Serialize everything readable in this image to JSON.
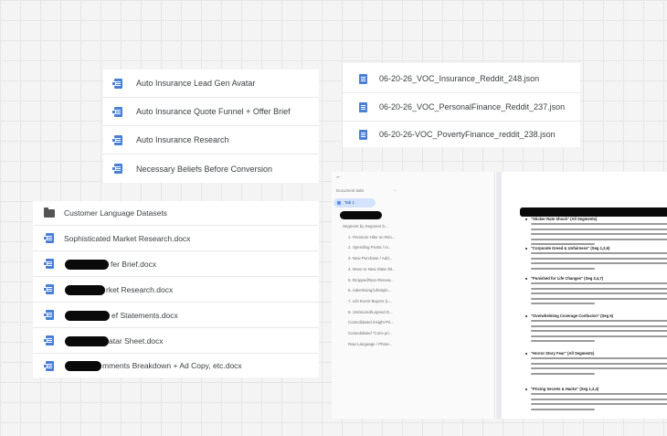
{
  "card_research": {
    "items": [
      "Auto Insurance Lead Gen Avatar",
      "Auto Insurance Quote Funnel + Offer Brief",
      "Auto Insurance Research",
      "Necessary Beliefs Before Conversion"
    ]
  },
  "card_json": {
    "items": [
      "06-20-26_VOC_Insurance_Reddit_248.json",
      "06-20-26_VOC_PersonalFinance_Reddit_237.json",
      "06-20-26-VOC_PovertyFinance_reddit_238.json"
    ]
  },
  "card_files": {
    "folder": "Customer Language Datasets",
    "items": [
      "Sophisticated Market Research.docx",
      "fer Brief.docx",
      "rket Research.docx",
      "ef Statements.docx",
      "atar Sheet.docx",
      "mments Breakdown + Ad Copy, etc.docx"
    ]
  },
  "doc_preview": {
    "back_label": "←",
    "outline_header": "Document tabs",
    "tab_label": "Tab 1",
    "outline_items": [
      "Segment by Segment b...",
      "1. Premium Hike on Ren...",
      "2. Spending Pivots / In...",
      "3. New Purchase / Add...",
      "4. Move to New State /M...",
      "5. Dropped/Non-Renew...",
      "6. Advertising/Lifestyle...",
      "7. Life Event Buyers (L...",
      "8. Uninsured/Lapsed D...",
      "Consolidated Insight Pri...",
      "Consolidated \"Conv pri...",
      "Raw Language / Phras..."
    ],
    "bullets": [
      "\"Sticker Rate Shock\" (All Segments)",
      "\"Corporate Greed & Unfairness\" (Seg 1,2,6)",
      "\"Punished for Life Changes\" (Seg 3,4,7)",
      "\"Overwhelming Coverage Confusion\" (Seg 6)",
      "\"Horror Story Fear\" (All Segments)",
      "\"Pricing Secrets & Hacks\" (Seg 1,2,4)"
    ]
  }
}
